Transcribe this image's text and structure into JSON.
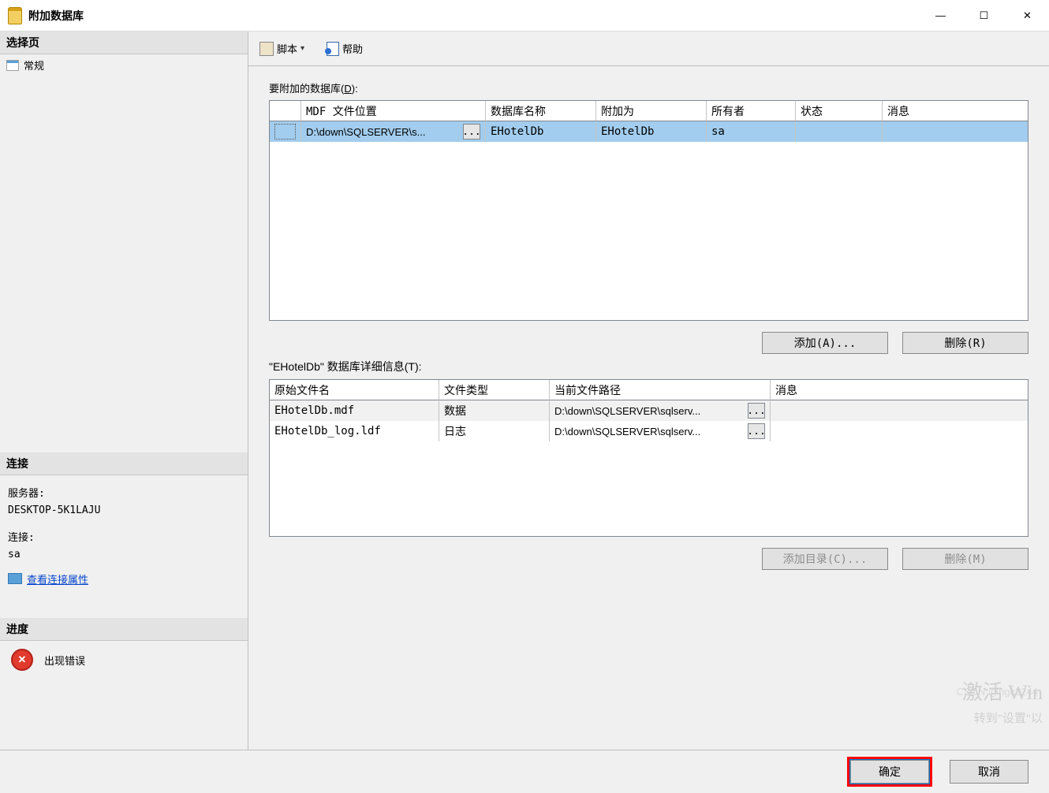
{
  "window": {
    "title": "附加数据库"
  },
  "titlebar_controls": {
    "min": "—",
    "max": "☐",
    "close": "✕"
  },
  "sidebar": {
    "select_page": "选择页",
    "general": "常规",
    "connection_title": "连接",
    "server_label": "服务器:",
    "server_value": "DESKTOP-5K1LAJU",
    "conn_label": "连接:",
    "conn_value": "sa",
    "view_props": "查看连接属性",
    "progress_title": "进度",
    "progress_status": "出现错误"
  },
  "toolbar": {
    "script": "脚本",
    "help": "帮助"
  },
  "main": {
    "attach_label_pre": "要附加的数据库(",
    "attach_label_u": "D",
    "attach_label_post": "):",
    "db_headers": {
      "mdf": "MDF 文件位置",
      "dbname": "数据库名称",
      "attach_as": "附加为",
      "owner": "所有者",
      "status": "状态",
      "message": "消息"
    },
    "db_row": {
      "mdf": "D:\\down\\SQLSERVER\\s...",
      "dbname": "EHotelDb",
      "attach_as": "EHotelDb",
      "owner": "sa",
      "status": "",
      "message": ""
    },
    "add_btn": "添加(A)...",
    "remove_btn": "删除(R)",
    "details_label": "\"EHotelDb\" 数据库详细信息(T):",
    "det_headers": {
      "orig": "原始文件名",
      "type": "文件类型",
      "path": "当前文件路径",
      "msg": "消息"
    },
    "det_rows": [
      {
        "orig": "EHotelDb.mdf",
        "type": "数据",
        "path": "D:\\down\\SQLSERVER\\sqlserv...",
        "msg": ""
      },
      {
        "orig": "EHotelDb_log.ldf",
        "type": "日志",
        "path": "D:\\down\\SQLSERVER\\sqlserv...",
        "msg": ""
      }
    ],
    "add_dir_btn": "添加目录(C)...",
    "remove2_btn": "删除(M)"
  },
  "footer": {
    "ok": "确定",
    "cancel": "取消"
  },
  "watermark": {
    "line1": "激活 Win",
    "line2": "转到\"设置\"以",
    "csdn": "CSDN @ngc2244"
  },
  "glyph": {
    "ellipsis": "...",
    "err_x": "✕"
  }
}
